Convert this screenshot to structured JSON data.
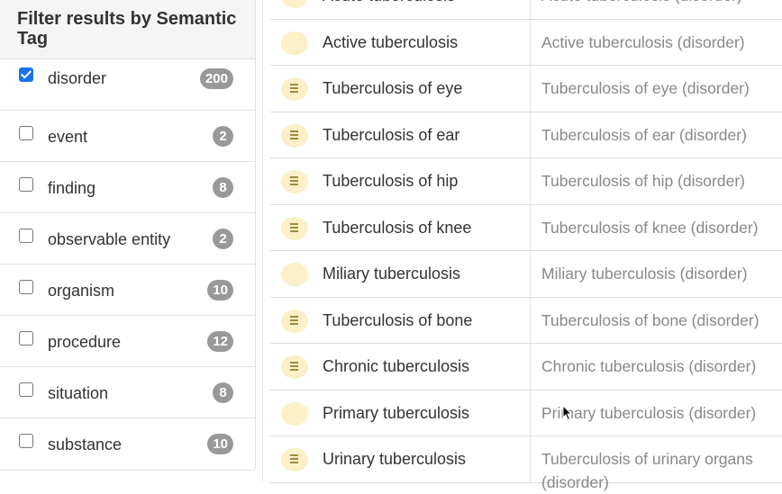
{
  "filter_panel": {
    "heading": "Filter results by Semantic Tag",
    "facets": [
      {
        "label": "disorder",
        "count": "200",
        "checked": true
      },
      {
        "label": "event",
        "count": "2",
        "checked": false
      },
      {
        "label": "finding",
        "count": "8",
        "checked": false
      },
      {
        "label": "observable entity",
        "count": "2",
        "checked": false
      },
      {
        "label": "organism",
        "count": "10",
        "checked": false
      },
      {
        "label": "procedure",
        "count": "12",
        "checked": false
      },
      {
        "label": "situation",
        "count": "8",
        "checked": false
      },
      {
        "label": "substance",
        "count": "10",
        "checked": false
      }
    ]
  },
  "results": [
    {
      "term": "Acute tuberculosis",
      "fsn": "Acute tuberculosis (disorder)",
      "icon": "empty-circle-icon"
    },
    {
      "term": "Active tuberculosis",
      "fsn": "Active tuberculosis (disorder)",
      "icon": "empty-circle-icon"
    },
    {
      "term": "Tuberculosis of eye",
      "fsn": "Tuberculosis of eye (disorder)",
      "icon": "lines-circle-icon"
    },
    {
      "term": "Tuberculosis of ear",
      "fsn": "Tuberculosis of ear (disorder)",
      "icon": "lines-circle-icon"
    },
    {
      "term": "Tuberculosis of hip",
      "fsn": "Tuberculosis of hip (disorder)",
      "icon": "lines-circle-icon"
    },
    {
      "term": "Tuberculosis of knee",
      "fsn": "Tuberculosis of knee (disorder)",
      "icon": "lines-circle-icon"
    },
    {
      "term": "Miliary tuberculosis",
      "fsn": "Miliary tuberculosis (disorder)",
      "icon": "empty-circle-icon"
    },
    {
      "term": "Tuberculosis of bone",
      "fsn": "Tuberculosis of bone (disorder)",
      "icon": "lines-circle-icon"
    },
    {
      "term": "Chronic tuberculosis",
      "fsn": "Chronic tuberculosis (disorder)",
      "icon": "lines-circle-icon"
    },
    {
      "term": "Primary tuberculosis",
      "fsn": "Primary tuberculosis (disorder)",
      "icon": "empty-circle-icon"
    },
    {
      "term": "Urinary tuberculosis",
      "fsn": "Tuberculosis of urinary organs (disorder)",
      "icon": "lines-circle-icon"
    }
  ],
  "colors": {
    "badge": "#999999",
    "checkbox_checked": "#1a73e8",
    "icon_circle": "#fbf0c8"
  }
}
